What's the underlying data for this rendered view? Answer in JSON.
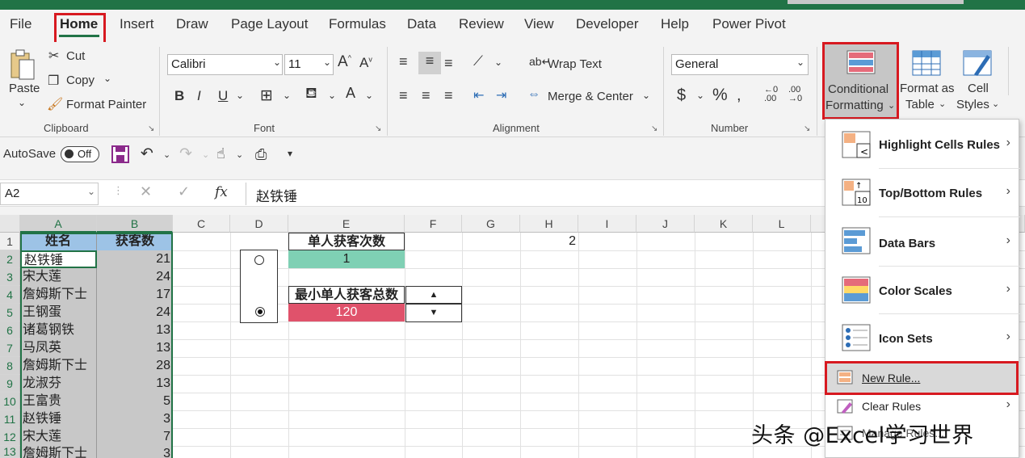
{
  "tabs": [
    "File",
    "Home",
    "Insert",
    "Draw",
    "Page Layout",
    "Formulas",
    "Data",
    "Review",
    "View",
    "Developer",
    "Help",
    "Power Pivot"
  ],
  "clipboard": {
    "paste": "Paste",
    "cut": "Cut",
    "copy": "Copy",
    "format_painter": "Format Painter",
    "group": "Clipboard"
  },
  "font": {
    "name": "Calibri",
    "size": "11",
    "group": "Font",
    "bold": "B",
    "italic": "I",
    "underline": "U"
  },
  "alignment": {
    "wrap": "Wrap Text",
    "merge": "Merge & Center",
    "group": "Alignment"
  },
  "number": {
    "format": "General",
    "currency": "$",
    "percent": "%",
    "group": "Number"
  },
  "styles": {
    "cond1": "Conditional",
    "cond2": "Formatting",
    "fat1": "Format as",
    "fat2": "Table",
    "cs1": "Cell",
    "cs2": "Styles"
  },
  "qat": {
    "autosave": "AutoSave",
    "toggle": "Off"
  },
  "formula_bar": {
    "name_box": "A2",
    "fx": "fx",
    "value": "赵铁锤"
  },
  "columns": [
    "A",
    "B",
    "C",
    "D",
    "E",
    "F",
    "G",
    "H",
    "I",
    "J",
    "K",
    "L"
  ],
  "rows": [
    "1",
    "2",
    "3",
    "4",
    "5",
    "6",
    "7",
    "8",
    "9",
    "10",
    "11",
    "12",
    "13"
  ],
  "table": {
    "header": [
      "姓名",
      "获客数"
    ],
    "rows": [
      [
        "赵铁锤",
        "21"
      ],
      [
        "宋大莲",
        "24"
      ],
      [
        "詹姆斯下士",
        "17"
      ],
      [
        "王钢蛋",
        "24"
      ],
      [
        "诸葛钢铁",
        "13"
      ],
      [
        "马凤英",
        "13"
      ],
      [
        "詹姆斯下士",
        "28"
      ],
      [
        "龙淑芬",
        "13"
      ],
      [
        "王富贵",
        "5"
      ],
      [
        "赵铁锤",
        "3"
      ],
      [
        "宋大莲",
        "7"
      ],
      [
        "詹姆斯下士",
        "3"
      ]
    ]
  },
  "panel": {
    "label1": "单人获客次数",
    "value1": "1",
    "label2": "最小单人获客总数",
    "value2": "120"
  },
  "h1_value": "2",
  "menu": {
    "items": [
      "Highlight Cells Rules",
      "Top/Bottom Rules",
      "Data Bars",
      "Color Scales",
      "Icon Sets",
      "New Rule...",
      "Clear Rules",
      "Manage Rules..."
    ]
  },
  "watermark": "头条 @Excel学习世界",
  "colors": {
    "excel_green": "#217346",
    "highlight_red": "#d71920",
    "header_blue": "#9dc3e6",
    "teal": "#7fd0b4",
    "pink": "#e0526b"
  }
}
